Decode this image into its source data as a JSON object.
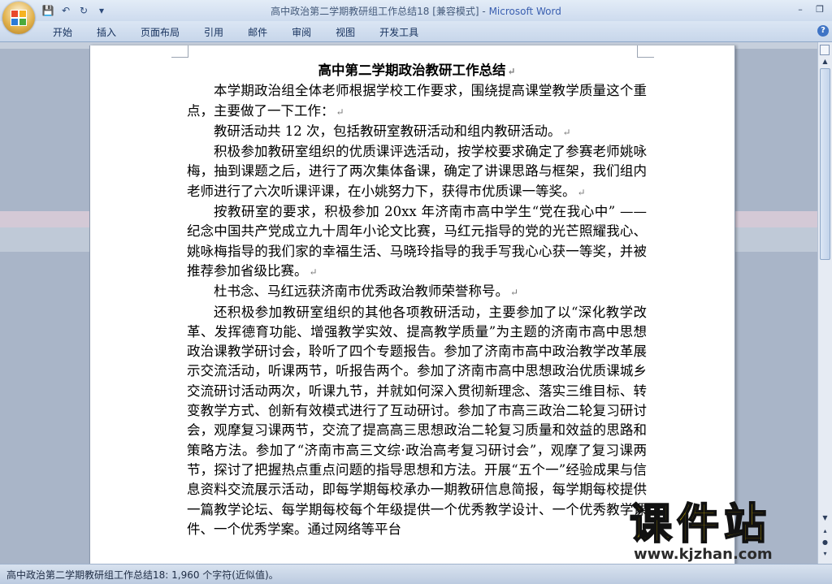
{
  "titlebar": {
    "document_title": "高中政治第二学期教研组工作总结18 [兼容模式]",
    "separator": " - ",
    "app_name": "Microsoft Word",
    "qat": {
      "save": "💾",
      "undo": "↶",
      "redo": "↻",
      "customize": "▾"
    },
    "controls": {
      "minimize": "–",
      "restore": "❐"
    }
  },
  "ribbon": {
    "tabs": [
      "开始",
      "插入",
      "页面布局",
      "引用",
      "邮件",
      "审阅",
      "视图",
      "开发工具"
    ],
    "help": "?"
  },
  "document": {
    "title": "高中第二学期政治教研工作总结",
    "paragraphs": [
      "本学期政治组全体老师根据学校工作要求，围绕提高课堂教学质量这个重点，主要做了一下工作：",
      "教研活动共 12 次，包括教研室教研活动和组内教研活动。",
      "积极参加教研室组织的优质课评选活动，按学校要求确定了参赛老师姚咏梅，抽到课题之后，进行了两次集体备课，确定了讲课思路与框架，我们组内老师进行了六次听课评课，在小姚努力下，获得市优质课一等奖。",
      "按教研室的要求，积极参加 20xx 年济南市高中学生“党在我心中” ——纪念中国共产党成立九十周年小论文比赛，马红元指导的党的光芒照耀我心、姚咏梅指导的我们家的幸福生活、马晓玲指导的我手写我心心获一等奖，并被推荐参加省级比赛。",
      "杜书念、马红远获济南市优秀政治教师荣誉称号。",
      "还积极参加教研室组织的其他各项教研活动，主要参加了以“深化教学改革、发挥德育功能、增强教学实效、提高教学质量”为主题的济南市高中思想政治课教学研讨会，聆听了四个专题报告。参加了济南市高中政治教学改革展示交流活动，听课两节，听报告两个。参加了济南市高中思想政治优质课城乡交流研讨活动两次，听课九节，并就如何深入贯彻新理念、落实三维目标、转变教学方式、创新有效模式进行了互动研讨。参加了市高三政治二轮复习研讨会，观摩复习课两节，交流了提高高三思想政治二轮复习质量和效益的思路和策略方法。参加了“济南市高三文综·政治高考复习研讨会”，观摩了复习课两节，探讨了把握热点重点问题的指导思想和方法。开展“五个一”经验成果与信息资料交流展示活动，即每学期每校承办一期教研信息简报，每学期每校提供一篇教学论坛、每学期每校每个年级提供一个优秀教学设计、一个优秀教学课件、一个优秀学案。通过网络等平台"
    ],
    "paragraph_mark": "↵"
  },
  "scrollbar": {
    "up": "▲",
    "down": "▼",
    "prev_page": "▴",
    "browse": "●",
    "next_page": "▾"
  },
  "statusbar": {
    "text": "高中政治第二学期教研组工作总结18: 1,960 个字符(近似值)。"
  },
  "watermark": {
    "main": "课件站",
    "url": "www.kjzhan.com"
  }
}
